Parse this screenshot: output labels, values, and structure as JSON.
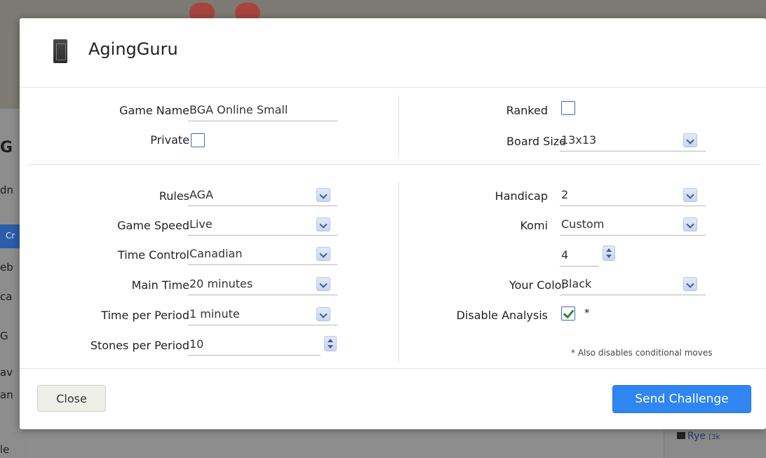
{
  "background": {
    "fragments": [
      "G",
      "dn",
      "Cr",
      "eb",
      "ca",
      "G",
      "av",
      "an",
      "le"
    ],
    "side_list_item": "Rye",
    "side_list_rank": "[3k"
  },
  "header": {
    "username": "AgingGuru"
  },
  "form": {
    "game_name": {
      "label": "Game Name",
      "value": "BGA Online Small"
    },
    "private": {
      "label": "Private",
      "checked": false
    },
    "ranked": {
      "label": "Ranked",
      "checked": false
    },
    "board_size": {
      "label": "Board Size",
      "value": "13x13"
    },
    "rules": {
      "label": "Rules",
      "value": "AGA"
    },
    "game_speed": {
      "label": "Game Speed",
      "value": "Live"
    },
    "time_control": {
      "label": "Time Control",
      "value": "Canadian"
    },
    "main_time": {
      "label": "Main Time",
      "value": "20 minutes"
    },
    "time_per_period": {
      "label": "Time per Period",
      "value": "1 minute"
    },
    "stones_per_period": {
      "label": "Stones per Period",
      "value": "10"
    },
    "handicap": {
      "label": "Handicap",
      "value": "2"
    },
    "komi": {
      "label": "Komi",
      "value": "Custom",
      "custom_value": "4"
    },
    "your_color": {
      "label": "Your Color",
      "value": "Black"
    },
    "disable_analysis": {
      "label": "Disable Analysis",
      "checked": true,
      "asterisk": "*"
    },
    "note": "* Also disables conditional moves"
  },
  "footer": {
    "close_label": "Close",
    "send_label": "Send Challenge"
  },
  "colors": {
    "primary_button": "#2f86f0",
    "checkbox_border": "#3a6db5",
    "check_mark": "#2d8a2d"
  }
}
